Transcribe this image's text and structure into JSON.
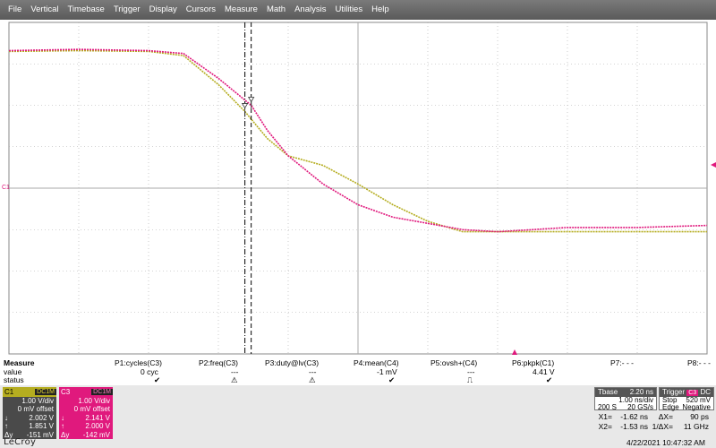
{
  "menu": [
    "File",
    "Vertical",
    "Timebase",
    "Trigger",
    "Display",
    "Cursors",
    "Measure",
    "Math",
    "Analysis",
    "Utilities",
    "Help"
  ],
  "colors": {
    "c1": "#b5ad20",
    "c3": "#e0197d",
    "grid": "#aaaaaa",
    "menubar": "#6a6a6a"
  },
  "plot": {
    "channel_marker_label": "C1",
    "trigger_arrow": "trigger-level-arrow-icon",
    "cursor_icons": [
      "cursor-x1-icon",
      "cursor-x2-icon"
    ]
  },
  "chart_data": {
    "type": "line",
    "x_unit": "ns",
    "xlim": [
      -5.0,
      5.0
    ],
    "ylim": [
      -4.0,
      4.0
    ],
    "y_unit": "V",
    "grid": true,
    "cursors_x": [
      -1.62,
      -1.53
    ],
    "series": [
      {
        "name": "C1",
        "x": [
          -5.0,
          -4.0,
          -3.0,
          -2.5,
          -2.0,
          -1.62,
          -1.3,
          -1.0,
          -0.5,
          0.0,
          0.5,
          1.0,
          1.5,
          2.0,
          2.5,
          3.0,
          4.0,
          5.0
        ],
        "y": [
          3.3,
          3.32,
          3.3,
          3.2,
          2.5,
          1.85,
          1.2,
          0.78,
          0.55,
          0.1,
          -0.4,
          -0.8,
          -1.05,
          -1.05,
          -1.05,
          -1.05,
          -1.05,
          -1.05
        ]
      },
      {
        "name": "C3",
        "x": [
          -5.0,
          -4.0,
          -3.0,
          -2.5,
          -2.0,
          -1.53,
          -1.3,
          -1.0,
          -0.5,
          0.0,
          0.5,
          1.0,
          1.5,
          2.0,
          2.5,
          3.0,
          4.0,
          5.0
        ],
        "y": [
          3.32,
          3.35,
          3.32,
          3.25,
          2.65,
          2.0,
          1.4,
          0.78,
          0.1,
          -0.4,
          -0.7,
          -0.85,
          -1.0,
          -1.05,
          -1.0,
          -0.95,
          -0.95,
          -0.9
        ]
      }
    ]
  },
  "measure": {
    "title": "Measure",
    "row_value": "value",
    "row_status": "status",
    "params": [
      {
        "name": "P1:cycles(C3)",
        "value": "0 cyc",
        "status": "✔"
      },
      {
        "name": "P2:freq(C3)",
        "value": "---",
        "status": "⚠"
      },
      {
        "name": "P3:duty@lv(C3)",
        "value": "---",
        "status": "⚠"
      },
      {
        "name": "P4:mean(C4)",
        "value": "-1 mV",
        "status": "✔"
      },
      {
        "name": "P5:ovsh+(C4)",
        "value": "---",
        "status": "⎍"
      },
      {
        "name": "P6:pkpk(C1)",
        "value": "4.41 V",
        "status": "✔"
      },
      {
        "name": "P7:- - -",
        "value": "",
        "status": ""
      },
      {
        "name": "P8:- - -",
        "value": "",
        "status": ""
      }
    ]
  },
  "c1": {
    "label": "C1",
    "coupling": "DC1M",
    "vdiv": "1.00 V/div",
    "offset": "0 mV offset",
    "v1": "2.002 V",
    "v2": "1.851 V",
    "dy": "-151 mV",
    "sym1": "↓",
    "sym2": "↑",
    "sym3": "Δy"
  },
  "c3": {
    "label": "C3",
    "coupling": "DC1M",
    "vdiv": "1.00 V/div",
    "offset": "0 mV offset",
    "v1": "2.141 V",
    "v2": "2.000 V",
    "dy": "-142 mV",
    "sym1": "↓",
    "sym2": "↑",
    "sym3": "Δy"
  },
  "tbase": {
    "label": "Tbase",
    "value": "2.20 ns",
    "row2_left": "",
    "row2_right": "1.00 ns/div",
    "row3_left": "200 S",
    "row3_right": "20 GS/s"
  },
  "trigger": {
    "label": "Trigger",
    "source": "C3",
    "coupling": "DC",
    "mode": "Stop",
    "level": "520 mV",
    "type": "Edge",
    "slope": "Negative"
  },
  "cursors": {
    "x1_label": "X1=",
    "x1": "-1.62 ns",
    "dx_label": "ΔX=",
    "dx": "90 ps",
    "x2_label": "X2=",
    "x2": "-1.53 ns",
    "inv_label": "1/ΔX=",
    "inv": "11 GHz"
  },
  "logo": "LeCroy",
  "datetime": "4/22/2021 10:47:32 AM"
}
